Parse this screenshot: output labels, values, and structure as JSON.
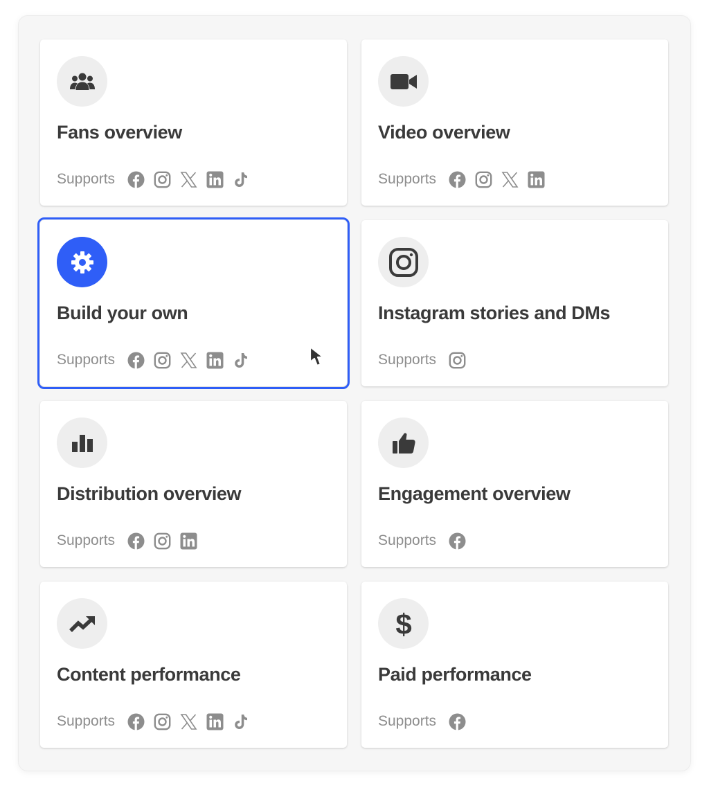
{
  "cards": [
    {
      "title": "Fans overview",
      "icon": "people-icon",
      "supports_label": "Supports",
      "networks": [
        "facebook",
        "instagram",
        "x",
        "linkedin",
        "tiktok"
      ],
      "selected": false
    },
    {
      "title": "Video overview",
      "icon": "video-camera-icon",
      "supports_label": "Supports",
      "networks": [
        "facebook",
        "instagram",
        "x",
        "linkedin"
      ],
      "selected": false
    },
    {
      "title": "Build your own",
      "icon": "gear-icon",
      "supports_label": "Supports",
      "networks": [
        "facebook",
        "instagram",
        "x",
        "linkedin",
        "tiktok"
      ],
      "selected": true
    },
    {
      "title": "Instagram stories and DMs",
      "icon": "instagram-icon",
      "supports_label": "Supports",
      "networks": [
        "instagram"
      ],
      "selected": false
    },
    {
      "title": "Distribution overview",
      "icon": "bar-chart-icon",
      "supports_label": "Supports",
      "networks": [
        "facebook",
        "instagram",
        "linkedin"
      ],
      "selected": false
    },
    {
      "title": "Engagement overview",
      "icon": "thumbs-up-icon",
      "supports_label": "Supports",
      "networks": [
        "facebook"
      ],
      "selected": false
    },
    {
      "title": "Content performance",
      "icon": "trending-up-icon",
      "supports_label": "Supports",
      "networks": [
        "facebook",
        "instagram",
        "x",
        "linkedin",
        "tiktok"
      ],
      "selected": false
    },
    {
      "title": "Paid performance",
      "icon": "dollar-icon",
      "supports_label": "Supports",
      "networks": [
        "facebook"
      ],
      "selected": false
    }
  ],
  "colors": {
    "accent": "#2f5ef7",
    "icon_dark": "#3a3a3a",
    "network_gray": "#8d8d8d"
  }
}
